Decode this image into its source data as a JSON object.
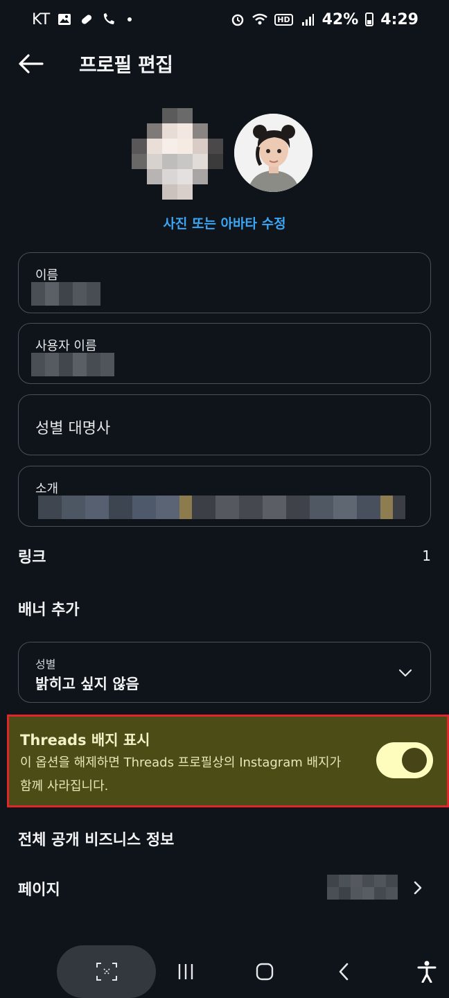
{
  "status_bar": {
    "carrier": "KT",
    "hd": "HD",
    "battery": "42%",
    "time": "4:29",
    "icons": [
      "gallery-icon",
      "pill-icon",
      "wifi-call-icon",
      "alarm-icon",
      "wifi-icon",
      "signal-icon",
      "battery-icon"
    ]
  },
  "header": {
    "title": "프로필 편집",
    "back_icon": "arrow-left-icon"
  },
  "profile": {
    "edit_photo_label": "사진 또는 아바타 수정"
  },
  "fields": {
    "name_label": "이름",
    "username_label": "사용자 이름",
    "pronouns_label": "성별 대명사",
    "bio_label": "소개"
  },
  "links": {
    "label": "링크",
    "count": "1"
  },
  "banner": {
    "label": "배너 추가"
  },
  "gender": {
    "label": "성별",
    "value": "밝히고 싶지 않음"
  },
  "threads_badge": {
    "title": "Threads 배지 표시",
    "description": "이 옵션을 해제하면 Threads 프로필상의 Instagram 배지가 함께 사라집니다.",
    "enabled": true
  },
  "business": {
    "section_title": "전체 공개 비즈니스 정보",
    "page_label": "페이지"
  },
  "colors": {
    "accent_link": "#3aa6f5",
    "highlight_bg": "#4b4c16",
    "highlight_border": "#e0262a",
    "toggle_on": "#fefdbd"
  }
}
